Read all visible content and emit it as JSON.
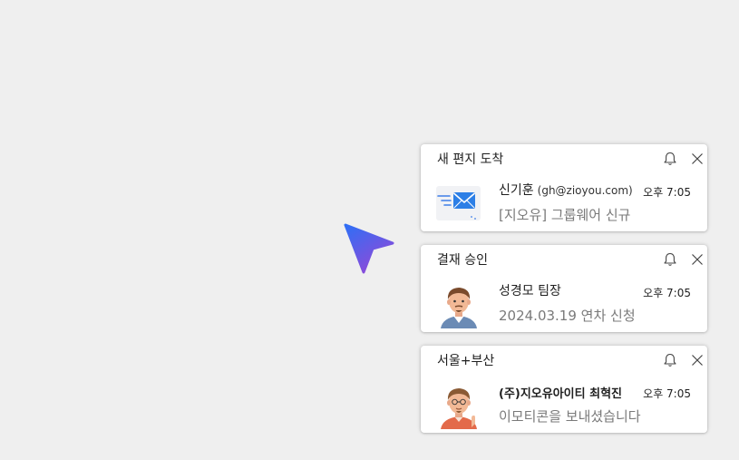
{
  "notifications": [
    {
      "title": "새 편지 도착",
      "sender": "신기훈",
      "email": "(gh@zioyou.com)",
      "time": "오후 7:05",
      "preview": "[지오유] 그룹웨어 신규",
      "icon": "mail-icon"
    },
    {
      "title": "결재 승인",
      "sender": "성경모 팀장",
      "time": "오후 7:05",
      "preview": "2024.03.19 연차 신청",
      "icon": "avatar"
    },
    {
      "title": "서울+부산",
      "sender": "(주)지오유아이티 최혁진",
      "time": "오후 7:05",
      "preview": "이모티콘을 보내셨습니다",
      "icon": "avatar"
    }
  ],
  "colors": {
    "background": "#efefef",
    "card": "#ffffff",
    "pointer_top": "#3b7bff",
    "pointer_bottom": "#8a4bd8",
    "mail_blue": "#2d7fe6"
  }
}
